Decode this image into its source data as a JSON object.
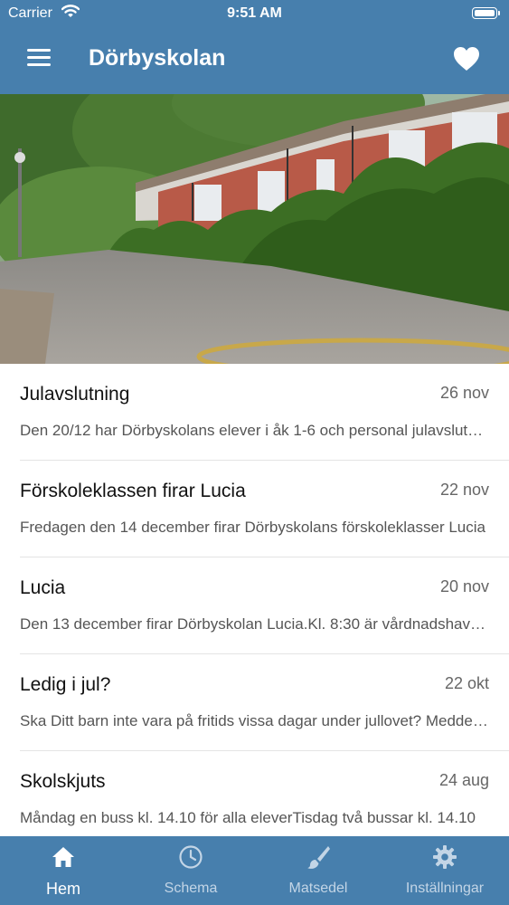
{
  "status_bar": {
    "carrier": "Carrier",
    "time": "9:51 AM"
  },
  "header": {
    "title": "Dörbyskolan"
  },
  "icons": {
    "menu": "hamburger-icon",
    "favorite": "heart-icon",
    "home": "home-icon",
    "schedule": "clock-icon",
    "menu_food": "brush-icon",
    "settings": "gear-icon"
  },
  "colors": {
    "primary": "#477fad",
    "inactive_tab": "#c3d5e6"
  },
  "news": [
    {
      "title": "Julavslutning",
      "date": "26 nov",
      "excerpt": "Den 20/12 har Dörbyskolans elever i åk 1-6 och personal julavslutning"
    },
    {
      "title": "Förskoleklassen firar Lucia",
      "date": "22 nov",
      "excerpt": "Fredagen den 14 december firar Dörbyskolans förskoleklasser Lucia"
    },
    {
      "title": "Lucia",
      "date": "20 nov",
      "excerpt": "Den 13 december firar Dörbyskolan Lucia.Kl. 8:30 är vårdnadshavare välkomna"
    },
    {
      "title": "Ledig i jul?",
      "date": "22 okt",
      "excerpt": "Ska Ditt barn inte vara på fritids vissa dagar under jullovet? Meddela oss"
    },
    {
      "title": "Skolskjuts",
      "date": "24 aug",
      "excerpt": "Måndag en buss kl. 14.10 för alla eleverTisdag två bussar kl. 14.10"
    }
  ],
  "tabs": [
    {
      "label": "Hem",
      "active": true
    },
    {
      "label": "Schema",
      "active": false
    },
    {
      "label": "Matsedel",
      "active": false
    },
    {
      "label": "Inställningar",
      "active": false
    }
  ]
}
